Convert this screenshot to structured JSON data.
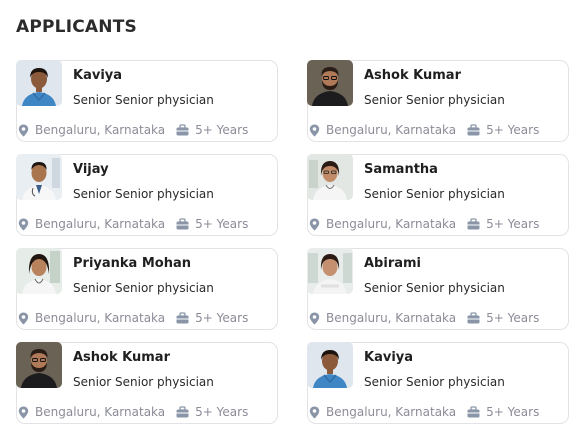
{
  "page": {
    "title": "APPLICANTS"
  },
  "colors": {
    "border": "#e3e3e6",
    "meta_text": "#8c8c98",
    "icon": "#8a96a8"
  },
  "applicants": [
    {
      "name": "Kaviya",
      "role": "Senior Senior physician",
      "location": "Bengaluru, Karnataka",
      "experience": "5+ Years",
      "avatar": "female-doctor-scrubs"
    },
    {
      "name": "Ashok Kumar",
      "role": "Senior Senior physician",
      "location": "Bengaluru, Karnataka",
      "experience": "5+ Years",
      "avatar": "bearded-man"
    },
    {
      "name": "Vijay",
      "role": "Senior Senior physician",
      "location": "Bengaluru, Karnataka",
      "experience": "5+ Years",
      "avatar": "male-doctor-coat"
    },
    {
      "name": "Samantha",
      "role": "Senior Senior physician",
      "location": "Bengaluru, Karnataka",
      "experience": "5+ Years",
      "avatar": "female-doctor-coat"
    },
    {
      "name": "Priyanka Mohan",
      "role": "Senior Senior physician",
      "location": "Bengaluru, Karnataka",
      "experience": "5+ Years",
      "avatar": "female-doctor-coat"
    },
    {
      "name": "Abirami",
      "role": "Senior Senior physician",
      "location": "Bengaluru, Karnataka",
      "experience": "5+ Years",
      "avatar": "female-doctor-coat"
    },
    {
      "name": "Ashok Kumar",
      "role": "Senior Senior physician",
      "location": "Bengaluru, Karnataka",
      "experience": "5+ Years",
      "avatar": "bearded-man"
    },
    {
      "name": "Kaviya",
      "role": "Senior Senior physician",
      "location": "Bengaluru, Karnataka",
      "experience": "5+ Years",
      "avatar": "female-doctor-scrubs"
    }
  ]
}
